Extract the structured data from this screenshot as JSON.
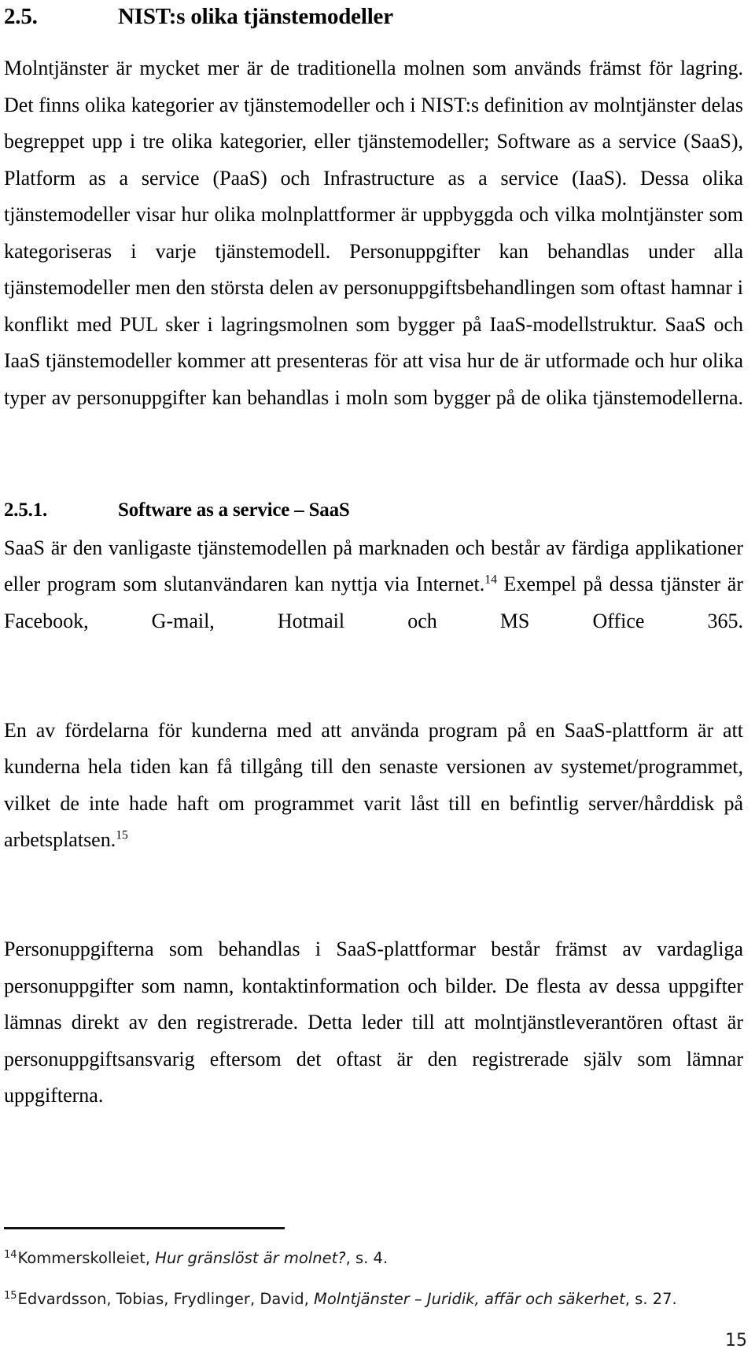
{
  "document": {
    "page_number": "15"
  },
  "section": {
    "number": "2.5.",
    "title": "NIST:s olika tjänstemodeller"
  },
  "paragraphs": {
    "intro_part1": "Molntjänster är mycket mer är de traditionella molnen som används främst för lagring. Det finns olika kategorier av tjänstemodeller och i NIST:s definition av molntjänster delas begreppet upp i tre olika kategorier, eller tjänstemodeller; Software as a service (SaaS), Platform as a service (PaaS) och Infrastructure as a service (IaaS). Dessa olika tjänstemodeller visar hur olika molnplattformer är uppbyggda och vilka molntjänster som kategoriseras i varje tjänstemodell. Personuppgifter kan behandlas under alla tjänstemodeller men den största delen av personuppgiftsbehandlingen som oftast hamnar i konflikt med PUL sker i lagringsmolnen som bygger på IaaS-modellstruktur. SaaS och IaaS tjänstemodeller kommer att presenteras för att visa hur de är utformade och hur olika typer av personuppgifter kan behandlas i moln som bygger på de olika tjänstemodellerna."
  },
  "subsection": {
    "number": "2.5.1.",
    "title": "Software as a service – SaaS",
    "paragraph_1_before_note": "SaaS är den vanligaste tjänstemodellen på marknaden och består av färdiga applikationer eller program som slutanvändaren kan nyttja via Internet.",
    "paragraph_1_note": "14",
    "paragraph_1_after_note": " Exempel på dessa tjänster är Facebook, G-mail, Hotmail och MS Office 365.",
    "paragraph_2_before_note": "En av fördelarna för kunderna med att använda program på en SaaS-plattform är att kunderna hela tiden kan få tillgång till den senaste versionen av systemet/programmet, vilket de inte hade haft om programmet varit låst till en befintlig server/hårddisk på arbetsplatsen.",
    "paragraph_2_note": "15",
    "paragraph_3": "Personuppgifterna som behandlas i SaaS-plattformar består främst av vardagliga personuppgifter som namn, kontaktinformation och bilder. De flesta av dessa uppgifter lämnas direkt av den registrerade. Detta leder till att molntjänstleverantören oftast är personuppgiftsansvarig eftersom det oftast är den registrerade själv som lämnar uppgifterna."
  },
  "footnotes": [
    {
      "mark": "14",
      "text_before_title": "Kommerskolleiet, ",
      "title": "Hur gränslöst är molnet?",
      "text_after_title": ", s. 4."
    },
    {
      "mark": "15",
      "text_before_title": "Edvardsson, Tobias, Frydlinger, David, ",
      "title": "Molntjänster – Juridik, affär och säkerhet",
      "text_after_title": ", s. 27."
    }
  ]
}
